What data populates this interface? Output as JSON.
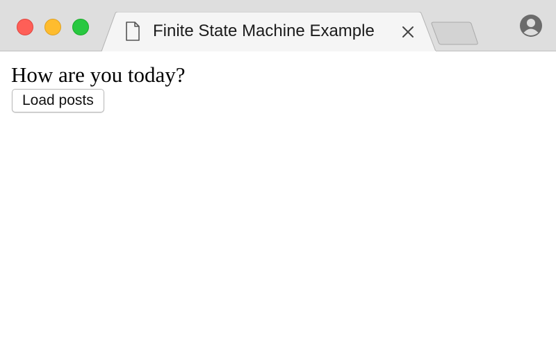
{
  "window": {
    "traffic_lights": {
      "close_color": "#fe5f57",
      "minimize_color": "#febc2e",
      "maximize_color": "#28c840"
    }
  },
  "tab": {
    "title": "Finite State Machine Example",
    "icon": "document-icon",
    "close_icon": "close-icon"
  },
  "toolbar": {
    "new_tab_icon": "new-tab-icon",
    "profile_icon": "profile-icon"
  },
  "page": {
    "heading": "How are you today?",
    "load_button_label": "Load posts"
  }
}
